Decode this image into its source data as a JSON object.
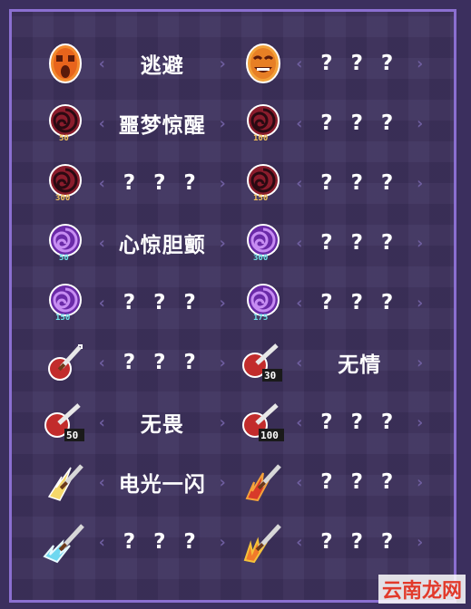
{
  "items": [
    {
      "label": "逃避",
      "icon": "orange-mask-icon"
    },
    {
      "label": "? ? ?",
      "icon": "laughing-mask-icon"
    },
    {
      "label": "噩梦惊醒",
      "icon": "red-vortex-50-icon",
      "badge": "50"
    },
    {
      "label": "? ? ?",
      "icon": "red-vortex-100-icon",
      "badge": "100"
    },
    {
      "label": "? ? ?",
      "icon": "red-vortex-300-icon",
      "badge": "300"
    },
    {
      "label": "? ? ?",
      "icon": "red-vortex-150-icon",
      "badge": "150"
    },
    {
      "label": "心惊胆颤",
      "icon": "purple-vortex-50-icon",
      "badge": "50"
    },
    {
      "label": "? ? ?",
      "icon": "purple-vortex-300-icon",
      "badge": "300"
    },
    {
      "label": "? ? ?",
      "icon": "purple-vortex-150-icon",
      "badge": "150"
    },
    {
      "label": "? ? ?",
      "icon": "purple-vortex-175-icon",
      "badge": "175"
    },
    {
      "label": "? ? ?",
      "icon": "red-dagger-icon"
    },
    {
      "label": "无情",
      "icon": "dagger-30-icon",
      "badge": "30"
    },
    {
      "label": "无畏",
      "icon": "dagger-50-icon",
      "badge": "50"
    },
    {
      "label": "? ? ?",
      "icon": "dagger-100-icon",
      "badge": "100"
    },
    {
      "label": "电光一闪",
      "icon": "yellow-spark-dagger-icon"
    },
    {
      "label": "? ? ?",
      "icon": "flame-dagger-icon"
    },
    {
      "label": "? ? ?",
      "icon": "ice-dagger-icon"
    },
    {
      "label": "? ? ?",
      "icon": "fire-feather-dagger-icon"
    }
  ],
  "watermark": "云南龙网",
  "colors": {
    "background": "#3b2f5e",
    "frame": "#8b6fd1",
    "bracket": "#6f5ea0",
    "text": "#ffffff"
  }
}
